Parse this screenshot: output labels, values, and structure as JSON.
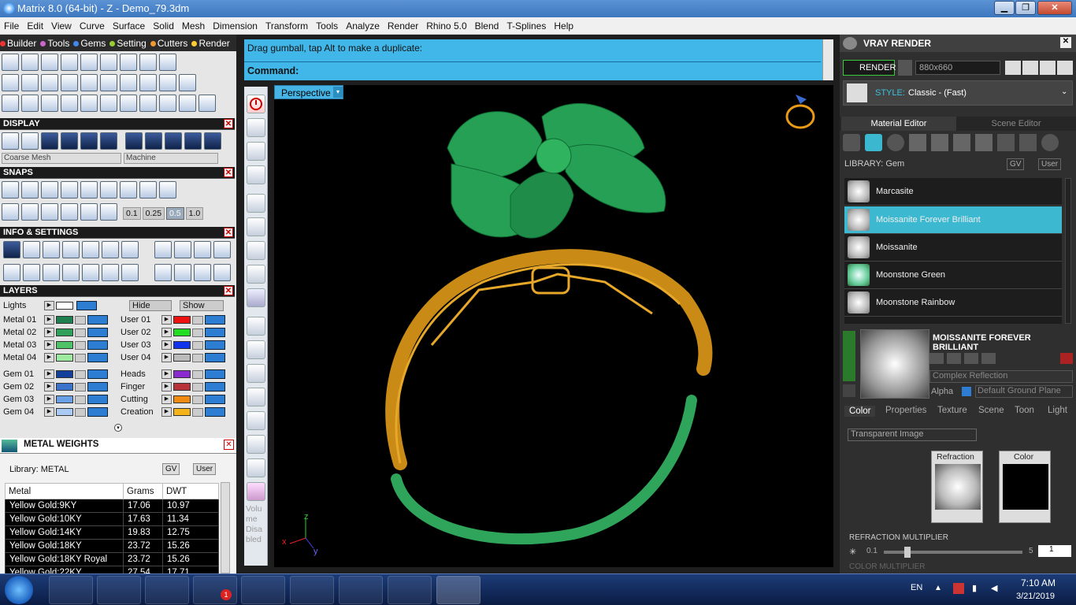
{
  "window": {
    "title": "Matrix 8.0 (64-bit) - Z - Demo_79.3dm",
    "min": "▁",
    "max": "❐",
    "close": "✕"
  },
  "menu": [
    "File",
    "Edit",
    "View",
    "Curve",
    "Surface",
    "Solid",
    "Mesh",
    "Dimension",
    "Transform",
    "Tools",
    "Analyze",
    "Render",
    "Rhino 5.0",
    "Blend",
    "T-Splines",
    "Help"
  ],
  "left": {
    "tabs": [
      "Builder",
      "Tools",
      "Gems",
      "Setting",
      "Cutters",
      "Render"
    ],
    "display": {
      "title": "DISPLAY",
      "mesh": "Coarse Mesh",
      "mode": "Machine"
    },
    "snaps": {
      "title": "SNAPS",
      "values": [
        "0.1",
        "0.25",
        "0.5",
        "1.0"
      ]
    },
    "info": {
      "title": "INFO & SETTINGS"
    },
    "layers": {
      "title": "LAYERS",
      "lights": "Lights",
      "hide": "Hide",
      "show": "Show",
      "left": [
        {
          "name": "Metal 01",
          "color": "#1f7f4f"
        },
        {
          "name": "Metal 02",
          "color": "#2ea05a"
        },
        {
          "name": "Metal 03",
          "color": "#4fc168"
        },
        {
          "name": "Metal 04",
          "color": "#9fe8a0"
        },
        {
          "name": "Gem 01",
          "color": "#123f9a"
        },
        {
          "name": "Gem 02",
          "color": "#3a73c9"
        },
        {
          "name": "Gem 03",
          "color": "#6aa0e6"
        },
        {
          "name": "Gem 04",
          "color": "#a9caf2"
        }
      ],
      "right": [
        {
          "name": "User 01",
          "color": "#ee1111"
        },
        {
          "name": "User 02",
          "color": "#22dd22"
        },
        {
          "name": "User 03",
          "color": "#1133ee"
        },
        {
          "name": "User 04",
          "color": "#bbbbbb"
        },
        {
          "name": "Heads",
          "color": "#8a2bd0"
        },
        {
          "name": "Finger",
          "color": "#b8323a"
        },
        {
          "name": "Cutting",
          "color": "#f08a10"
        },
        {
          "name": "Creation",
          "color": "#f5b31a"
        }
      ]
    },
    "weights": {
      "title": "METAL WEIGHTS",
      "library": "Library: METAL",
      "gv": "GV",
      "user": "User",
      "headers": [
        "Metal",
        "Grams",
        "DWT"
      ],
      "rows": [
        [
          "Yellow Gold:9KY",
          "17.06",
          "10.97"
        ],
        [
          "Yellow Gold:10KY",
          "17.63",
          "11.34"
        ],
        [
          "Yellow Gold:14KY",
          "19.83",
          "12.75"
        ],
        [
          "Yellow Gold:18KY",
          "23.72",
          "15.26"
        ],
        [
          "Yellow Gold:18KY Royal",
          "23.72",
          "15.26"
        ],
        [
          "Yellow Gold:22KY",
          "27.54",
          "17.71"
        ]
      ]
    }
  },
  "command": {
    "line1": "Drag gumball, tap Alt to make a duplicate:",
    "line2": "Command:"
  },
  "viewport": {
    "label": "Perspective",
    "axis_z": "z",
    "axis_x": "x",
    "axis_y": "y",
    "side_text": "Volume Disabled"
  },
  "right": {
    "title": "VRAY RENDER",
    "render_btn": "RENDER",
    "resolution": "880x660",
    "style_label": "STYLE:",
    "style_value": "Classic - (Fast)",
    "tabs": [
      "Material Editor",
      "Scene Editor"
    ],
    "library": "LIBRARY: Gem",
    "gv": "GV",
    "user": "User",
    "materials": [
      "Marcasite",
      "Moissanite Forever Brilliant",
      "Moissanite",
      "Moonstone Green",
      "Moonstone Rainbow"
    ],
    "selected": "MOISSANITE FOREVER BRILLIANT",
    "reflection": "Complex Reflection",
    "alpha": "Alpha",
    "ground": "Default Ground Plane",
    "subtabs": [
      "Color",
      "Properties",
      "Texture",
      "Scene",
      "Toon",
      "Light"
    ],
    "transparent": "Transparent Image",
    "refraction": "Refraction",
    "color": "Color",
    "multiplier": "REFRACTION MULTIPLIER",
    "mult_min": "0.1",
    "mult_max": "5",
    "mult_val": "1",
    "color_mult": "COLOR MULTIPLIER"
  },
  "taskbar": {
    "lang": "EN",
    "time": "7:10 AM",
    "date": "3/21/2019",
    "badge": "1"
  }
}
